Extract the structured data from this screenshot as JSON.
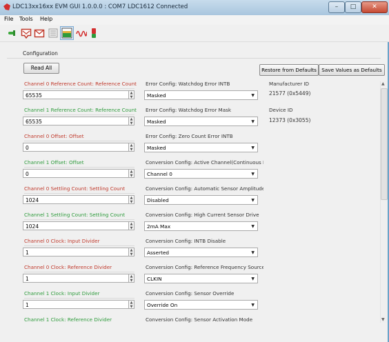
{
  "window": {
    "title": "LDC13xx16xx EVM GUI 1.0.0.0 : COM7 LDC1612 Connected",
    "minimize": "–",
    "maximize": "□",
    "close": "✕"
  },
  "menu": [
    "File",
    "Tools",
    "Help"
  ],
  "toolbar_icons": [
    "connect-icon",
    "message-icon",
    "mail-icon",
    "document-icon",
    "chart-icon",
    "waveform-icon",
    "indicator-icon"
  ],
  "section": {
    "label": "Configuration"
  },
  "buttons": {
    "read_all": "Read All",
    "restore": "Restore from Defaults",
    "save": "Save Values as Defaults"
  },
  "left_fields": [
    {
      "label": "Channel 0 Reference Count: Reference Count",
      "value": "65535",
      "color": "#c0392b"
    },
    {
      "label": "Channel 1 Reference Count: Reference Count",
      "value": "65535",
      "color": "#2e9b3c"
    },
    {
      "label": "Channel 0 Offset: Offset",
      "value": "0",
      "color": "#c0392b"
    },
    {
      "label": "Channel 1 Offset: Offset",
      "value": "0",
      "color": "#2e9b3c"
    },
    {
      "label": "Channel 0 Settling Count: Settling Count",
      "value": "1024",
      "color": "#c0392b"
    },
    {
      "label": "Channel 1 Settling Count: Settling Count",
      "value": "1024",
      "color": "#2e9b3c"
    },
    {
      "label": "Channel 0 Clock: Input Divider",
      "value": "1",
      "color": "#c0392b"
    },
    {
      "label": "Channel 0 Clock: Reference Divider",
      "value": "1",
      "color": "#c0392b"
    },
    {
      "label": "Channel 1 Clock: Input Divider",
      "value": "1",
      "color": "#2e9b3c"
    },
    {
      "label": "Channel 1 Clock: Reference Divider",
      "value": "1",
      "color": "#2e9b3c"
    }
  ],
  "mid_fields": [
    {
      "label": "Error Config: Watchdog Error INTB",
      "value": "Masked"
    },
    {
      "label": "Error Config: Watchdog Error Mask",
      "value": "Masked"
    },
    {
      "label": "Error Config: Zero Count Error INTB",
      "value": "Masked"
    },
    {
      "label": "Conversion Config: Active Channel(Continuous I",
      "value": "Channel 0"
    },
    {
      "label": "Conversion Config:  Automatic Sensor Amplitude",
      "value": "Disabled"
    },
    {
      "label": "Conversion Config: High Current Sensor Drive",
      "value": "2mA Max"
    },
    {
      "label": "Conversion Config: INTB Disable",
      "value": "Asserted"
    },
    {
      "label": "Conversion Config: Reference Frequency Source",
      "value": "CLKIN"
    },
    {
      "label": "Conversion Config: Sensor Override",
      "value": "Override On"
    },
    {
      "label": "Conversion Config: Sensor Activation Mode",
      "value": ""
    }
  ],
  "info": [
    {
      "label": "Manufacturer ID",
      "value": "21577 (0x5449)"
    },
    {
      "label": "Device ID",
      "value": "12373 (0x3055)"
    }
  ]
}
